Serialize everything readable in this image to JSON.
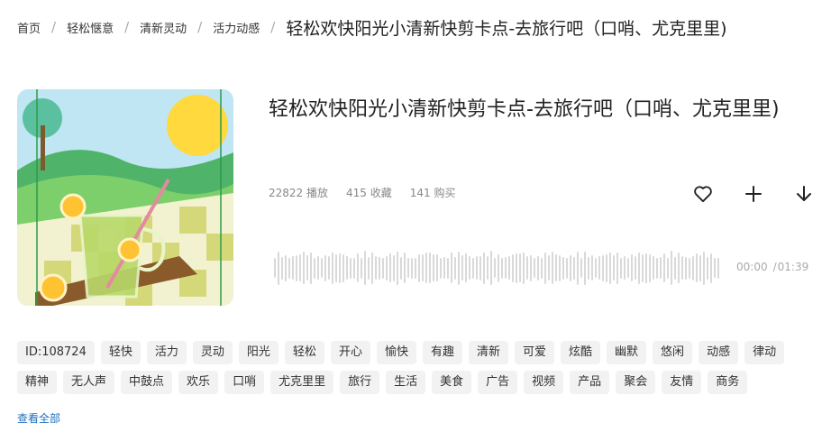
{
  "breadcrumb": {
    "items": [
      "首页",
      "轻松惬意",
      "清新灵动",
      "活力动感"
    ],
    "separator": "/",
    "current": "轻松欢快阳光小清新快剪卡点-去旅行吧（口哨、尤克里里)"
  },
  "track": {
    "title": "轻松欢快阳光小清新快剪卡点-去旅行吧（口哨、尤克里里)",
    "plays": "22822 播放",
    "favorites": "415 收藏",
    "purchases": "141 购买",
    "time_current": "00:00",
    "time_separator": "/",
    "time_total": "01:39"
  },
  "actions": {
    "favorite_icon": "heart-icon",
    "add_icon": "plus-icon",
    "download_icon": "arrow-down-icon"
  },
  "tags": [
    "ID:108724",
    "轻快",
    "活力",
    "灵动",
    "阳光",
    "轻松",
    "开心",
    "愉快",
    "有趣",
    "清新",
    "可爱",
    "炫酷",
    "幽默",
    "悠闲",
    "动感",
    "律动",
    "精神",
    "无人声",
    "中鼓点",
    "欢乐",
    "口哨",
    "尤克里里",
    "旅行",
    "生活",
    "美食",
    "广告",
    "视频",
    "产品",
    "聚会",
    "友情",
    "商务"
  ],
  "view_all": "查看全部",
  "colors": {
    "link": "#1f6fbf",
    "tag_bg": "#f2f2f2",
    "waveform": "#d9d9d9"
  }
}
